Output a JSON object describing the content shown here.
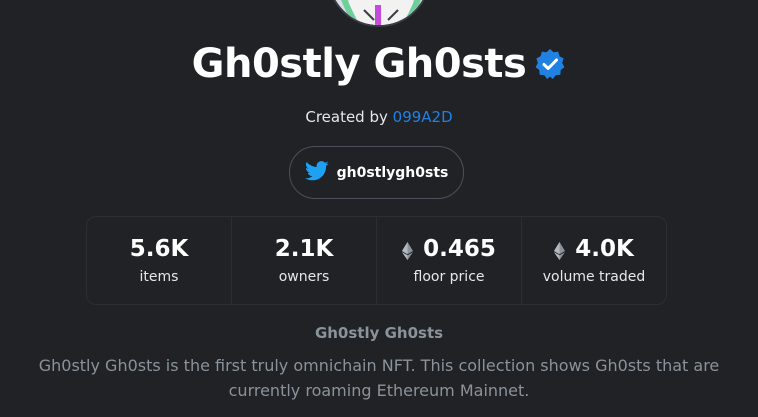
{
  "collection": {
    "name": "Gh0stly Gh0sts",
    "created_by_prefix": "Created by",
    "creator": "099A2D",
    "twitter_handle": "gh0stlygh0sts"
  },
  "stats": [
    {
      "value": "5.6K",
      "label": "items",
      "eth": false
    },
    {
      "value": "2.1K",
      "label": "owners",
      "eth": false
    },
    {
      "value": "0.465",
      "label": "floor price",
      "eth": true
    },
    {
      "value": "4.0K",
      "label": "volume traded",
      "eth": true
    }
  ],
  "description": {
    "title": "Gh0stly Gh0sts",
    "text": "Gh0stly Gh0sts is the first truly omnichain NFT. This collection shows Gh0sts that are currently roaming Ethereum Mainnet."
  },
  "colors": {
    "background": "#202225",
    "accent": "#2081e2",
    "twitter": "#1da1f2",
    "muted_text": "#8a939b"
  },
  "icons": {
    "verified": "verified-badge-icon",
    "twitter": "twitter-bird-icon",
    "eth": "ethereum-icon"
  }
}
